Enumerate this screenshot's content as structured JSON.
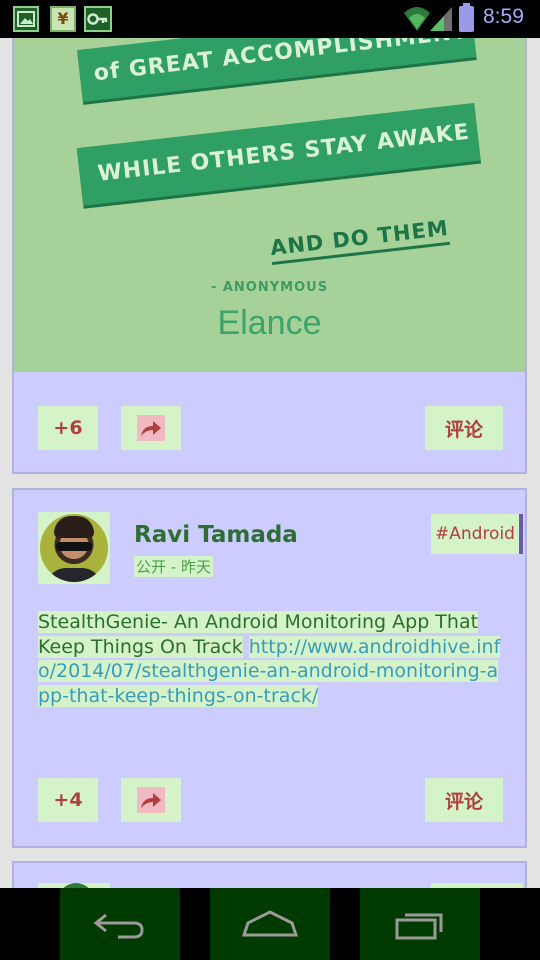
{
  "status_bar": {
    "time": "8:59",
    "notification_icons": [
      "image-icon",
      "yen-icon",
      "key-icon"
    ],
    "yen_symbol": "¥"
  },
  "posts": [
    {
      "image": {
        "line1": "of GREAT ACCOMPLISHMENTS",
        "line2": "WHILE OTHERS STAY AWAKE",
        "line3": "AND DO THEM",
        "attribution": "- ANONYMOUS",
        "logo": "Elance"
      },
      "plus_label": "+6",
      "comment_label": "评论"
    },
    {
      "author": "Ravi Tamada",
      "meta": "公开 - 昨天",
      "tag": "#Android",
      "text": "StealthGenie- An Android Monitoring App That Keep Things On Track",
      "link": "http://www.androidhive.info/2014/07/stealthgenie-an-android-monitoring-app-that-keep-things-on-track/",
      "plus_label": "+4",
      "comment_label": "评论"
    }
  ],
  "colors": {
    "card_bg": "#ccccff",
    "highlight_bg": "#d4f3c8",
    "action_text": "#b04040",
    "link": "#3a9bbb",
    "poster_bg": "#a6d29a",
    "ribbon": "#2f9f63"
  },
  "nav_bar": {
    "back_icon": "back-icon",
    "home_icon": "home-icon",
    "recent_icon": "recent-apps-icon"
  }
}
